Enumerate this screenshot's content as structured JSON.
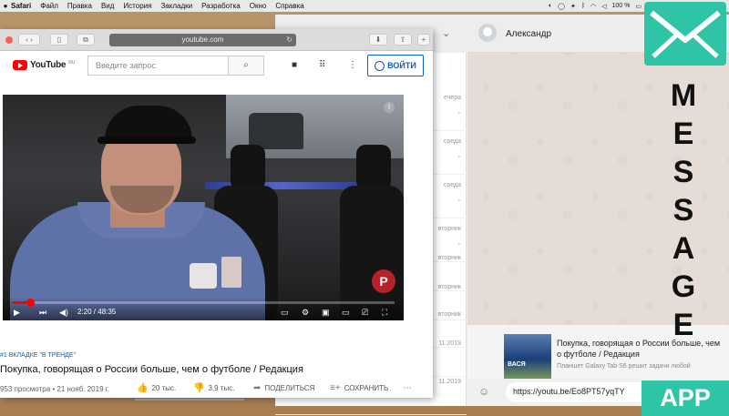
{
  "menubar": {
    "app": "Safari",
    "items": [
      "Файл",
      "Правка",
      "Вид",
      "История",
      "Закладки",
      "Разработка",
      "Окно",
      "Справка"
    ],
    "battery": "100 %"
  },
  "safari": {
    "url": "youtube.com"
  },
  "youtube": {
    "logo_text": "YouTube",
    "logo_region": "RU",
    "search_placeholder": "Введите запрос",
    "login_label": "ВОЙТИ",
    "player": {
      "time": "2:20 / 48:35",
      "progress": 0.048,
      "watermark": "P"
    },
    "trend_label": "#1 ВКЛАДКЕ \"В ТРЕНДЕ\"",
    "title": "Покупка, говорящая о России больше, чем о футболе / Редакция",
    "views_date": "953 просмотра • 21 нояб. 2019 г.",
    "likes": "20 тыс.",
    "dislikes": "3,9 тыс.",
    "share_label": "ПОДЕЛИТЬСЯ",
    "save_label": "СОХРАНИТЬ"
  },
  "whatsapp": {
    "contact_name": "Александр",
    "chat_meta": [
      "ечера",
      "среда",
      "среда",
      "вторник",
      "вторник",
      "вторник",
      "вторник",
      "11.2019",
      "11.2019"
    ],
    "preview": {
      "title": "Покупка, говорящая о России больше, чем о футболе / Редакция",
      "subtitle": "Планшет Galaxy Tab S6 решит задачи любой"
    },
    "composer_text": "https://youtu.be/Eo8PT57yqTY"
  },
  "message_app": {
    "letters": [
      "M",
      "E",
      "S",
      "S",
      "A",
      "G",
      "E"
    ],
    "badge": "APP",
    "accent": "#2fc4a6"
  }
}
